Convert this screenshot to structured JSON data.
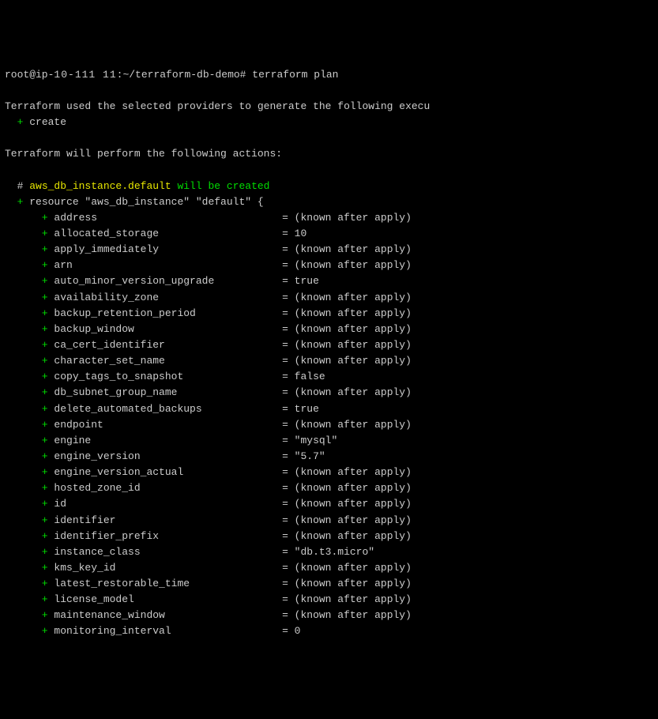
{
  "prompt_line": {
    "user_host": "root@ip-",
    "ip_partial": "10-111 11",
    "path_suffix": ":~/terraform-db-demo#",
    "command": " terraform plan"
  },
  "intro_line": "Terraform used the selected providers to generate the following execu",
  "create_prefix": "  + ",
  "create_label": "create",
  "perform_line": "Terraform will perform the following actions:",
  "resource_comment": {
    "hash": "  # ",
    "resource": "aws_db_instance.default",
    "suffix": " will be created"
  },
  "resource_decl": {
    "plus": "  + ",
    "text": "resource \"aws_db_instance\" \"default\" {"
  },
  "attr_prefix": "      + ",
  "attributes": [
    {
      "name": "address",
      "value": "(known after apply)"
    },
    {
      "name": "allocated_storage",
      "value": "10"
    },
    {
      "name": "apply_immediately",
      "value": "(known after apply)"
    },
    {
      "name": "arn",
      "value": "(known after apply)"
    },
    {
      "name": "auto_minor_version_upgrade",
      "value": "true"
    },
    {
      "name": "availability_zone",
      "value": "(known after apply)"
    },
    {
      "name": "backup_retention_period",
      "value": "(known after apply)"
    },
    {
      "name": "backup_window",
      "value": "(known after apply)"
    },
    {
      "name": "ca_cert_identifier",
      "value": "(known after apply)"
    },
    {
      "name": "character_set_name",
      "value": "(known after apply)"
    },
    {
      "name": "copy_tags_to_snapshot",
      "value": "false"
    },
    {
      "name": "db_subnet_group_name",
      "value": "(known after apply)"
    },
    {
      "name": "delete_automated_backups",
      "value": "true"
    },
    {
      "name": "endpoint",
      "value": "(known after apply)"
    },
    {
      "name": "engine",
      "value": "\"mysql\""
    },
    {
      "name": "engine_version",
      "value": "\"5.7\""
    },
    {
      "name": "engine_version_actual",
      "value": "(known after apply)"
    },
    {
      "name": "hosted_zone_id",
      "value": "(known after apply)"
    },
    {
      "name": "id",
      "value": "(known after apply)"
    },
    {
      "name": "identifier",
      "value": "(known after apply)"
    },
    {
      "name": "identifier_prefix",
      "value": "(known after apply)"
    },
    {
      "name": "instance_class",
      "value": "\"db.t3.micro\""
    },
    {
      "name": "kms_key_id",
      "value": "(known after apply)"
    },
    {
      "name": "latest_restorable_time",
      "value": "(known after apply)"
    },
    {
      "name": "license_model",
      "value": "(known after apply)"
    },
    {
      "name": "maintenance_window",
      "value": "(known after apply)"
    },
    {
      "name": "monitoring_interval",
      "value": "0"
    }
  ],
  "name_col_width": 37
}
